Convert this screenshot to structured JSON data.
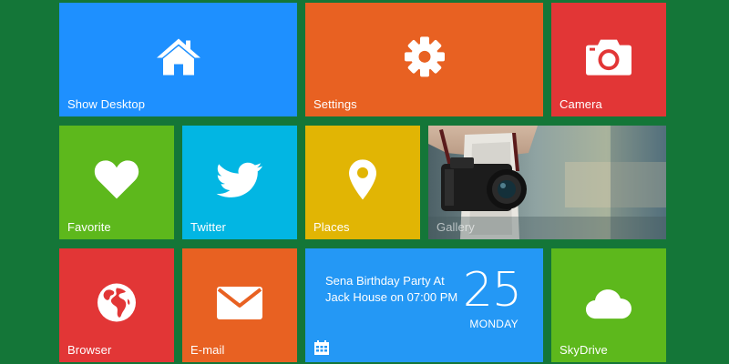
{
  "colors": {
    "background": "#147638",
    "blue": "#1E90FF",
    "orange": "#E86122",
    "red": "#E23636",
    "green": "#5DB81C",
    "cyan": "#02B6E3",
    "yellow": "#E1B504",
    "calendar_blue": "#2498F5"
  },
  "tiles": {
    "show_desktop": {
      "label": "Show Desktop",
      "icon": "home-icon"
    },
    "settings": {
      "label": "Settings",
      "icon": "gear-icon"
    },
    "camera": {
      "label": "Camera",
      "icon": "camera-icon"
    },
    "favorite": {
      "label": "Favorite",
      "icon": "heart-icon"
    },
    "twitter": {
      "label": "Twitter",
      "icon": "bird-icon"
    },
    "places": {
      "label": "Places",
      "icon": "map-pin-icon"
    },
    "gallery": {
      "label": "Gallery",
      "icon": "photo"
    },
    "browser": {
      "label": "Browser",
      "icon": "globe-icon"
    },
    "email": {
      "label": "E-mail",
      "icon": "envelope-icon"
    },
    "calendar": {
      "event_line1": "Sena Birthday Party At",
      "event_line2": "Jack House on 07:00 PM",
      "day": "25",
      "weekday": "MONDAY",
      "icon": "calendar-icon"
    },
    "skydrive": {
      "label": "SkyDrive",
      "icon": "cloud-icon"
    }
  }
}
